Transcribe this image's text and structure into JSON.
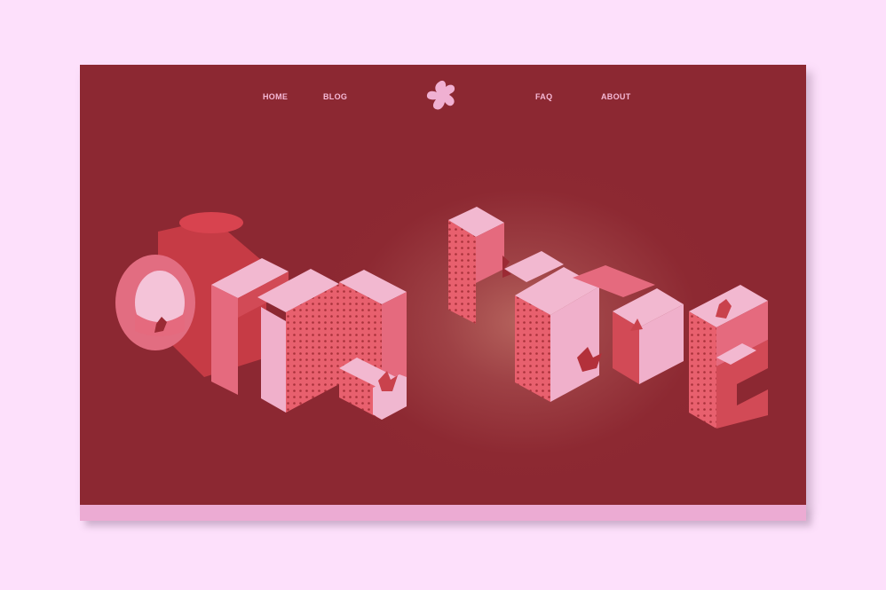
{
  "nav": {
    "items": [
      {
        "label": "HOME"
      },
      {
        "label": "BLOG"
      },
      {
        "label": "FAQ"
      },
      {
        "label": "ABOUT"
      }
    ],
    "logo_icon": "splat-star-icon"
  },
  "colors": {
    "page_background": "#fde0fb",
    "hero_background": "#8d2932",
    "glow": "#b6635d",
    "letter_top": "#f0b7d0",
    "letter_side": "#e56a7e",
    "letter_dark": "#c9424c",
    "band": "#ecabd3",
    "nav_text": "#f5b9d6"
  }
}
